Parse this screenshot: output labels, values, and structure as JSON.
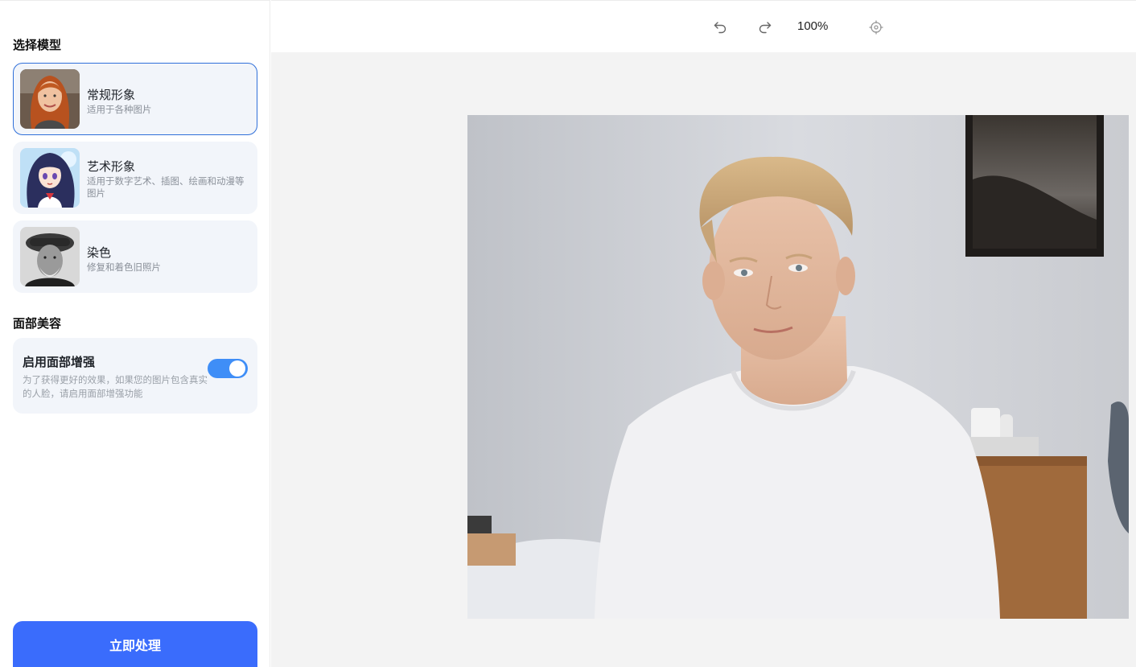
{
  "sidebar": {
    "model_section_title": "选择模型",
    "models": [
      {
        "name": "常规形象",
        "desc": "适用于各种图片",
        "selected": true
      },
      {
        "name": "艺术形象",
        "desc": "适用于数字艺术、插图、绘画和动漫等图片",
        "selected": false
      },
      {
        "name": "染色",
        "desc": "修复和着色旧照片",
        "selected": false
      }
    ],
    "face_section_title": "面部美容",
    "face": {
      "title": "启用面部增强",
      "desc": "为了获得更好的效果，如果您的图片包含真实的人脸，请启用面部增强功能",
      "enabled": true
    },
    "process_button": "立即处理"
  },
  "toolbar": {
    "zoom": "100%",
    "icons": [
      "undo-icon",
      "redo-icon",
      "locate-icon"
    ]
  },
  "colors": {
    "primary": "#3a6cfc",
    "toggle_on": "#3f8ef7",
    "selected_border": "#2f6fd9",
    "card_bg": "#f2f5fa",
    "canvas_bg": "#f3f3f3"
  }
}
